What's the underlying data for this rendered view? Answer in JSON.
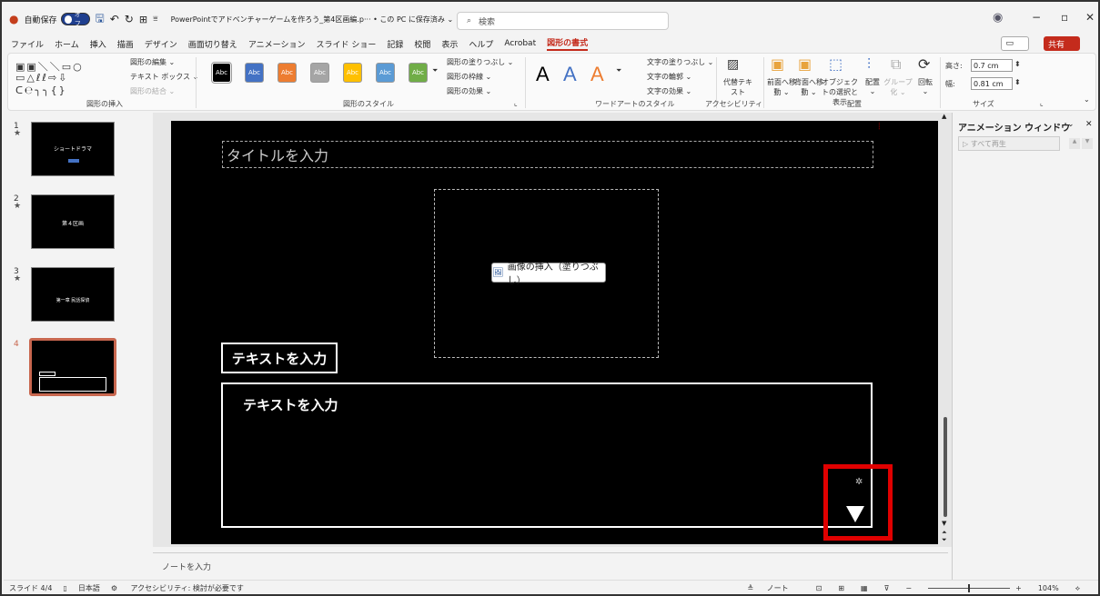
{
  "titlebar": {
    "autosave_label": "自動保存",
    "autosave_state": "オフ",
    "doc_title": "PowerPointでアドベンチャーゲームを作ろう_第4区画編.p··· • この PC に保存済み ⌄",
    "search_placeholder": "検索"
  },
  "menu": {
    "items": [
      "ファイル",
      "ホーム",
      "挿入",
      "描画",
      "デザイン",
      "画面切り替え",
      "アニメーション",
      "スライド ショー",
      "記録",
      "校閲",
      "表示",
      "ヘルプ",
      "Acrobat"
    ],
    "active": "図形の書式",
    "share": "共有"
  },
  "ribbon": {
    "insert_shapes": {
      "label": "図形の挿入",
      "edit": "図形の編集 ⌄",
      "textbox": "テキスト ボックス ⌄",
      "merge": "図形の結合 ⌄"
    },
    "shape_styles": {
      "label": "図形のスタイル",
      "swatch_text": "Abc",
      "fill": "図形の塗りつぶし ⌄",
      "outline": "図形の枠線 ⌄",
      "effects": "図形の効果 ⌄",
      "colors": [
        "#000000",
        "#4472c4",
        "#ed7d31",
        "#a5a5a5",
        "#ffc000",
        "#5b9bd5",
        "#70ad47"
      ]
    },
    "wordart": {
      "label": "ワードアートのスタイル",
      "glyph": "A",
      "text_fill": "文字の塗りつぶし ⌄",
      "text_outline": "文字の輪郭 ⌄",
      "text_effects": "文字の効果 ⌄"
    },
    "accessibility": {
      "label": "アクセシビリティ",
      "alt_text": "代替テキスト"
    },
    "arrange": {
      "label": "配置",
      "forward": "前面へ移動 ⌄",
      "backward": "背面へ移動 ⌄",
      "selection": "オブジェクトの選択と表示",
      "align": "配置 ⌄",
      "group": "グループ化 ⌄",
      "rotate": "回転 ⌄"
    },
    "size": {
      "label": "サイズ",
      "height_label": "高さ:",
      "height": "0.7 cm",
      "width_label": "幅:",
      "width": "0.81 cm"
    }
  },
  "slides": [
    {
      "num": "1",
      "star": "★",
      "caption": "ショートドラマ"
    },
    {
      "num": "2",
      "star": "★",
      "caption": "第４区画"
    },
    {
      "num": "3",
      "star": "★",
      "caption": "第一章 民話探偵"
    },
    {
      "num": "4",
      "star": "",
      "caption": ""
    }
  ],
  "slide": {
    "title_placeholder": "タイトルを入力",
    "image_button": "画像の挿入（塗りつぶし）",
    "text_small": "テキストを入力",
    "text_large": "テキストを入力"
  },
  "animation_pane": {
    "title": "アニメーション ウィンドウ",
    "play_all": "▷ すべて再生"
  },
  "notes": {
    "placeholder": "ノートを入力"
  },
  "status": {
    "slide": "スライド 4/4",
    "language": "日本語",
    "accessibility": "アクセシビリティ: 検討が必要です",
    "notes_btn": "ノート",
    "zoom": "104%"
  }
}
